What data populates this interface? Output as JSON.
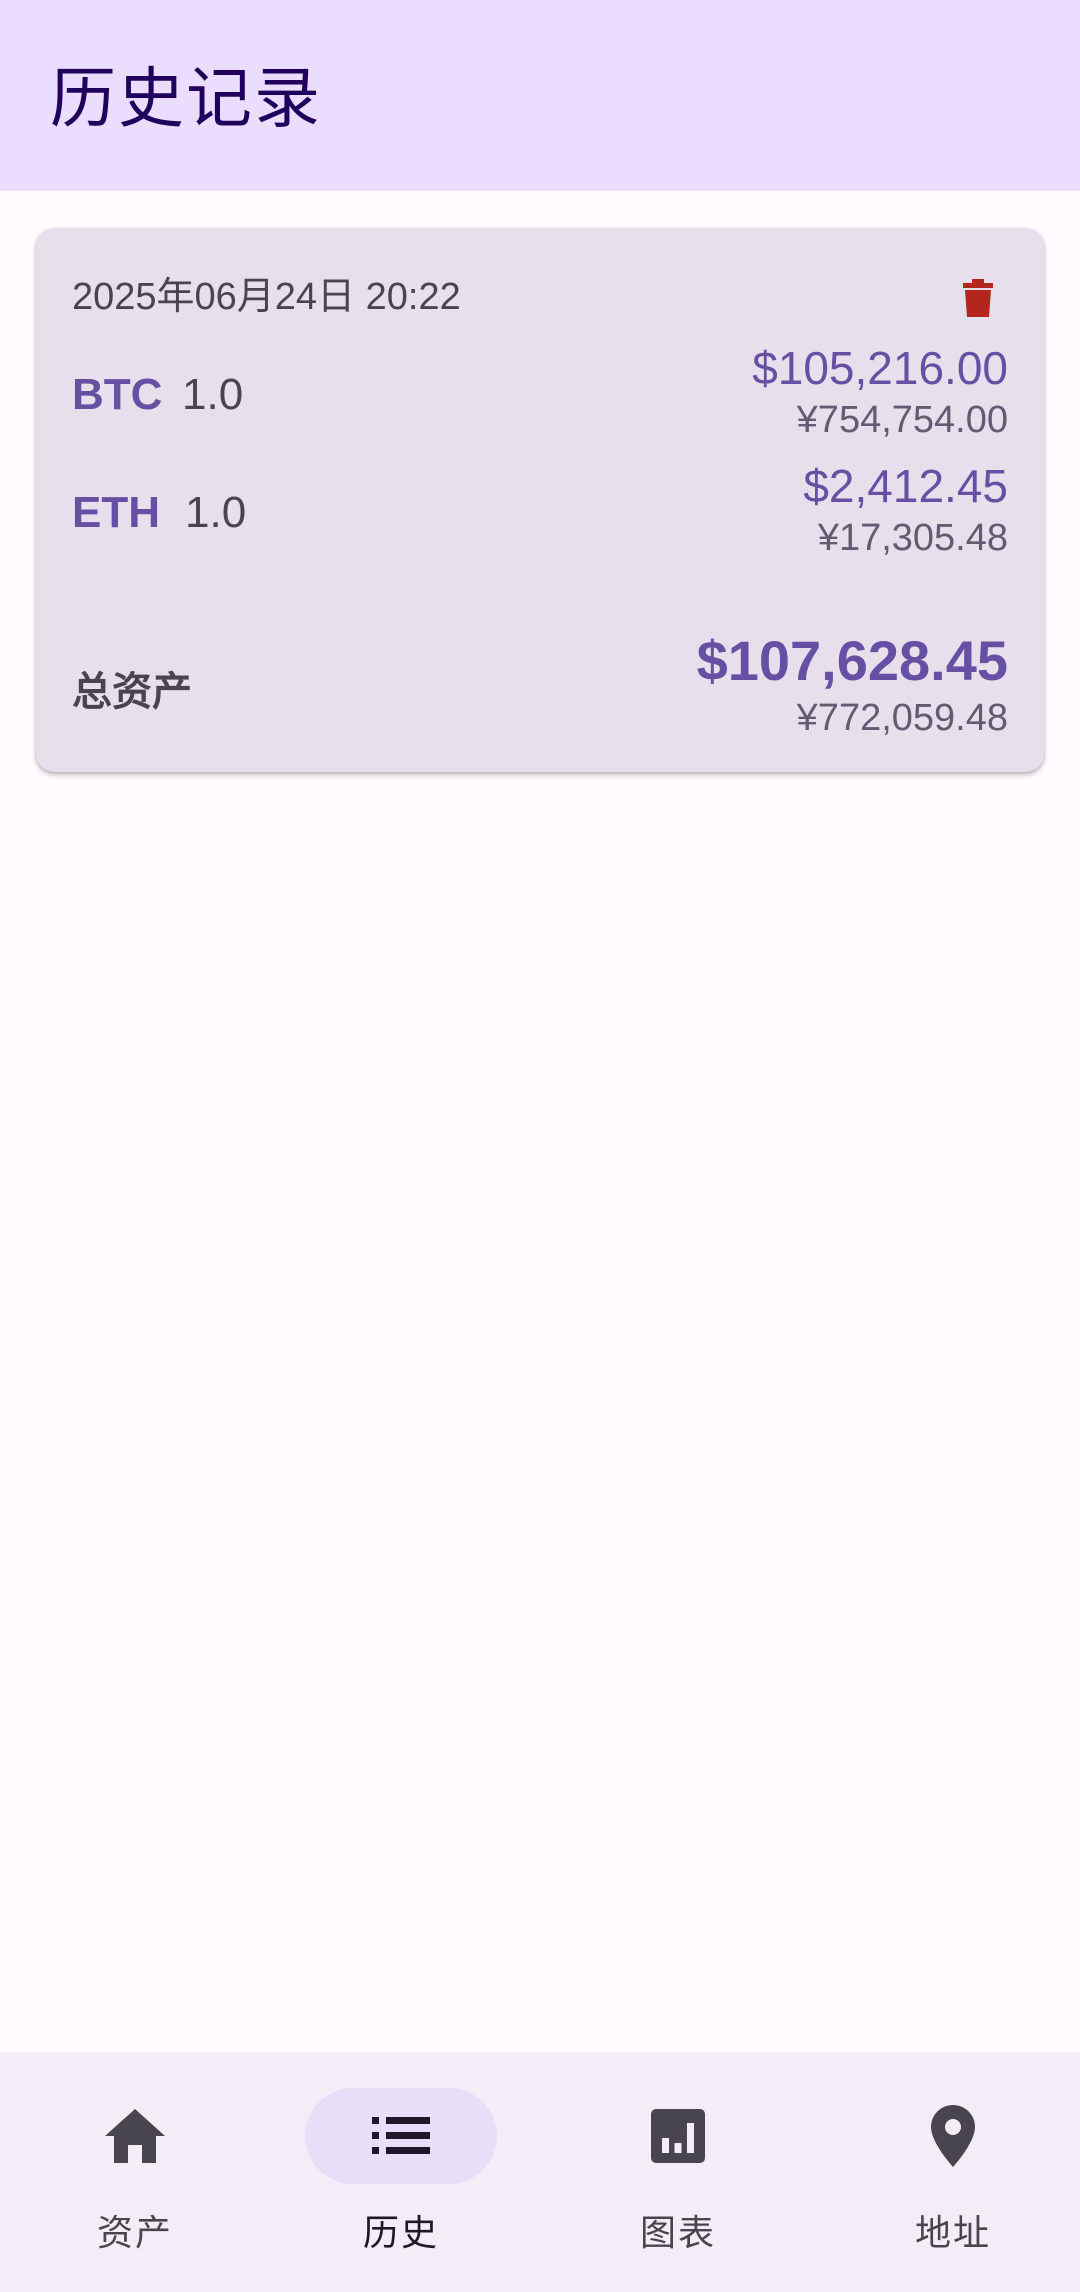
{
  "app_bar": {
    "title": "历史记录"
  },
  "record": {
    "timestamp": "2025年06月24日 20:22",
    "delete_icon": "trash-icon",
    "delete_color": "#b3261e",
    "coins": [
      {
        "symbol": "BTC",
        "amount": "1.0",
        "usd": "$105,216.00",
        "cny": "¥754,754.00"
      },
      {
        "symbol": "ETH",
        "amount": "1.0",
        "usd": "$2,412.45",
        "cny": "¥17,305.48"
      }
    ],
    "total": {
      "label": "总资产",
      "usd": "$107,628.45",
      "cny": "¥772,059.48"
    }
  },
  "bottom_nav": {
    "active": "history",
    "items": [
      {
        "key": "assets",
        "label": "资产",
        "icon": "home-icon"
      },
      {
        "key": "history",
        "label": "历史",
        "icon": "list-icon"
      },
      {
        "key": "charts",
        "label": "图表",
        "icon": "bar-chart-icon"
      },
      {
        "key": "address",
        "label": "地址",
        "icon": "location-pin-icon"
      }
    ]
  },
  "colors": {
    "app_bar_bg": "#eaddff",
    "title": "#21005d",
    "accent": "#6750a4",
    "card_bg": "#e7e0ec",
    "nav_bg": "#f3edf7",
    "nav_active_pill": "#e8def8"
  }
}
